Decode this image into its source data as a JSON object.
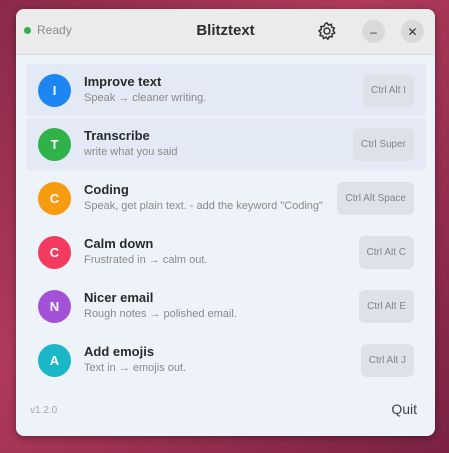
{
  "window": {
    "title": "Blitztext",
    "status": {
      "text": "Ready",
      "dot_color": "#2fb24a"
    },
    "settings_icon": "gear-icon",
    "minimize_glyph": "–",
    "close_glyph": "✕"
  },
  "items": [
    {
      "letter": "I",
      "color": "#1e86f0",
      "title": "Improve text",
      "desc": "Speak → cleaner writing.",
      "shortcut": "Ctrl Alt I"
    },
    {
      "letter": "T",
      "color": "#2fb24a",
      "title": "Transcribe",
      "desc": "write what you said",
      "shortcut": "Ctrl Super"
    },
    {
      "letter": "C",
      "color": "#f59c10",
      "title": "Coding",
      "desc": "Speak, get plain text. - add the keyword \"Coding\"",
      "shortcut": "Ctrl Alt Space"
    },
    {
      "letter": "C",
      "color": "#f33a60",
      "title": "Calm down",
      "desc": "Frustrated in → calm out.",
      "shortcut": "Ctrl Alt C"
    },
    {
      "letter": "N",
      "color": "#a351d6",
      "title": "Nicer email",
      "desc": "Rough notes → polished email.",
      "shortcut": "Ctrl Alt E"
    },
    {
      "letter": "A",
      "color": "#1bb7c9",
      "title": "Add emojis",
      "desc": "Text in → emojis out.",
      "shortcut": "Ctrl Alt J"
    }
  ],
  "footer": {
    "version": "v1.2.0",
    "quit_label": "Quit"
  }
}
